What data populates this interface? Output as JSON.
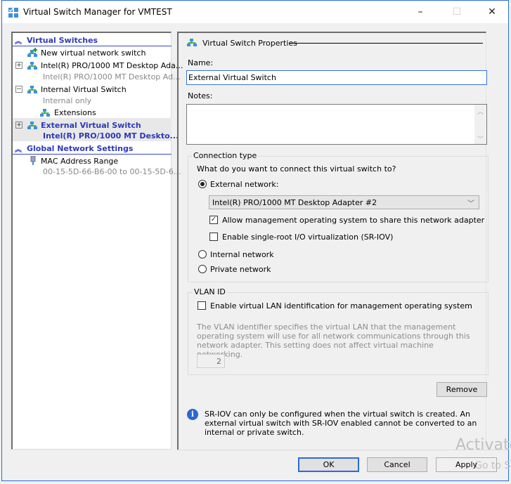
{
  "window": {
    "title": "Virtual Switch Manager for VMTEST",
    "minimize_glyph": "–",
    "maximize_glyph": "☐",
    "close_glyph": "✕"
  },
  "tree": {
    "virtual_switches_header": "Virtual Switches",
    "new_switch": "New virtual network switch",
    "switches": [
      {
        "name": "Intel(R) PRO/1000 MT Desktop Ada...",
        "sub": "Intel(R) PRO/1000 MT Desktop Ad...",
        "expander": "+"
      },
      {
        "name": "Internal Virtual Switch",
        "sub": "Internal only",
        "expander": "−",
        "child": "Extensions"
      },
      {
        "name": "External Virtual Switch",
        "sub": "Intel(R) PRO/1000 MT Deskto...",
        "expander": "+",
        "selected": true
      }
    ],
    "global_header": "Global Network Settings",
    "mac_range": {
      "name": "MAC Address Range",
      "sub": "00-15-5D-66-B6-00 to 00-15-5D-6..."
    },
    "collapse_glyph": "≈"
  },
  "properties": {
    "section_title": "Virtual Switch Properties",
    "name_label": "Name:",
    "name_value": "External Virtual Switch",
    "notes_label": "Notes:",
    "notes_value": "",
    "connection_type": {
      "legend": "Connection type",
      "question": "What do you want to connect this virtual switch to?",
      "external_label": "External network:",
      "external_selected": true,
      "adapter_selected": "Intel(R) PRO/1000 MT Desktop Adapter #2",
      "allow_mgmt_label": "Allow management operating system to share this network adapter",
      "allow_mgmt_checked": true,
      "sriov_label": "Enable single-root I/O virtualization (SR-IOV)",
      "sriov_checked": false,
      "internal_label": "Internal network",
      "private_label": "Private network"
    },
    "vlan": {
      "legend": "VLAN ID",
      "enable_label": "Enable virtual LAN identification for management operating system",
      "enable_checked": false,
      "description": "The VLAN identifier specifies the virtual LAN that the management operating system will use for all network communications through this network adapter. This setting does not affect virtual machine networking.",
      "vlan_value": "2"
    },
    "remove_label": "Remove",
    "info_text": "SR-IOV can only be configured when the virtual switch is created. An external virtual switch with SR-IOV enabled cannot be converted to an internal or private switch."
  },
  "footer": {
    "ok_label": "OK",
    "cancel_label": "Cancel",
    "apply_label": "Apply"
  },
  "watermark": {
    "line1": "Activate",
    "line2": "Go to Sett"
  }
}
